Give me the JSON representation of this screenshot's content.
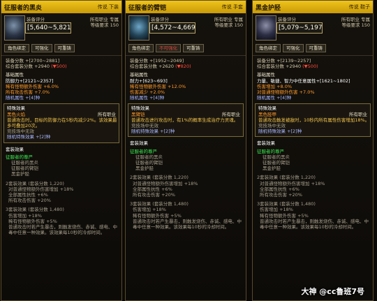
{
  "panels": [
    {
      "name": "征服者的黑炎",
      "tag": "传说 下装",
      "score_label": "装备评分",
      "score_value": "[5,640~5,821]",
      "job": "所有职业 专属",
      "level": "等级要求 150",
      "buttons": [
        "角色绑定",
        "可强化",
        "可重铸"
      ],
      "stat1": "装备分数 +[2700~2881]",
      "stat2": "综合套装分数 +2940",
      "stat2_delta": "(▼500)",
      "base_title": "基础属性",
      "base_lines": [
        "防御力+[2121~2357]"
      ],
      "orange_lines": [
        "稀有怪物额外伤害 +6.0%",
        "所有攻击伤害 +7.0%"
      ],
      "rand_attr": "随机属性 +[4]种",
      "effect_title": "特殊效果",
      "effect_name": "黑色火焰",
      "effect_job": "所有职业",
      "effect_desc": "普通攻击时，目标的防御力在5秒内减少2%。该效果最多可叠加20次。",
      "effect_pvp": "竞技场中无效",
      "rand_effect": "随机特殊效果 +[2]种",
      "set_title": "套装效果",
      "set_name": "征服者的尊严",
      "set_items": [
        "征服者的黑炎",
        "征服者的臂铠",
        "黑金护胫"
      ],
      "set2_head": "2套装效果 (套装分数 1,220)",
      "set2_lines": [
        "对普通怪物额外伤害增加 +18%",
        "全部属性抗性 +6%",
        "所有攻击伤害 +20%"
      ],
      "set3_head": "3套装效果 (套装分数 1,480)",
      "set3_lines": [
        "伤害增加 +18%",
        "稀有怪物额外伤害 +5%",
        "普通攻击时若产生暴击，则触发烧伤、赤诚、感电、中毒中任意一种效果。该效果每10秒的冷却时间。"
      ]
    },
    {
      "name": "征服者的臂铠",
      "tag": "传说 手套",
      "score_label": "装备评分",
      "score_value": "[4,572~4,669]",
      "job": "所有职业 专属",
      "level": "等级要求 150",
      "buttons": [
        "角色绑定",
        "不可强化",
        "可重铸"
      ],
      "stat1": "装备分数 +[1952~2049]",
      "stat2": "综合套装分数 +2620",
      "stat2_delta": "(▼820)",
      "base_title": "基础属性",
      "base_lines": [
        "耐力+[623~693]"
      ],
      "orange_lines": [
        "稀有怪物额外伤害 +12.0%",
        "伤害减少 +2.0%"
      ],
      "rand_attr": "随机属性 +[4]种",
      "effect_title": "特殊效果",
      "effect_name": "黑臂铠",
      "effect_job": "所有职业",
      "effect_desc": "普通攻击进行攻击时，有1%的概率生成治疗力灵魂。",
      "effect_pvp": "竞技场中无效",
      "rand_effect": "随机特殊效果 +[2]种",
      "set_title": "套装效果",
      "set_name": "征服者的尊严",
      "set_items": [
        "征服者的黑炎",
        "征服者的臂铠",
        "黑金护胫"
      ],
      "set2_head": "2套装效果 (套装分数 1,220)",
      "set2_lines": [
        "对普通怪物额外伤害增加 +18%",
        "全部属性抗性 +6%",
        "所有攻击伤害 +20%"
      ],
      "set3_head": "3套装效果 (套装分数 1,480)",
      "set3_lines": [
        "伤害增加 +18%",
        "稀有怪物额外伤害 +5%",
        "普通攻击时若产生暴击，则触发烧伤、赤诚、感电、中毒中任意一种效果。该效果每10秒的冷却时间。"
      ]
    },
    {
      "name": "黑金护胫",
      "tag": "传说 鞋子",
      "score_label": "装备评分",
      "score_value": "[5,079~5,197]",
      "job": "所有职业 专属",
      "level": "等级要求 150",
      "buttons": [
        "角色绑定",
        "可强化",
        "可重铸"
      ],
      "stat1": "装备分数 +[2139~2257]",
      "stat2": "综合套装分数 +2940",
      "stat2_delta": "(▼500)",
      "base_title": "基础属性",
      "base_lines": [
        "力量、敏捷、智力中任意属性+[1621~1802]"
      ],
      "orange_lines": [
        "伤害增加 +8.0%",
        "对普通怪物额外伤害 +7.0%"
      ],
      "rand_attr": "随机属性 +[4]种",
      "effect_title": "特殊效果",
      "effect_name": "黑色胫甲",
      "effect_job": "所有职业",
      "effect_desc": "普通攻击触发被敌时，10秒内所有属性伤害增加18%。",
      "effect_pvp": "竞技场中无效",
      "rand_effect": "随机特殊效果 +[2]种",
      "set_title": "套装效果",
      "set_name": "征服者的尊严",
      "set_items": [
        "征服者的黑炎",
        "征服者的臂铠",
        "黑金护胫"
      ],
      "set2_head": "2套装效果 (套装分数 1,220)",
      "set2_lines": [
        "对普通怪物额外伤害增加 +18%",
        "全部属性抗性 +6%",
        "所有攻击伤害 +20%"
      ],
      "set3_head": "3套装效果 (套装分数 1,480)",
      "set3_lines": [
        "伤害增加 +18%",
        "稀有怪物额外伤害 +5%",
        "普通攻击时若产生暴击，则触发烧伤、赤诚、感电、中毒中任意一种效果。该效果每10秒的冷却时间。"
      ]
    }
  ],
  "watermark": "大神 @cc鲁班7号",
  "colors": {
    "header": "#f0c419",
    "legendary_border": "#5a4a2a",
    "orange": "#ff9a2b",
    "green": "#39e94e",
    "red": "#ff4b3a"
  }
}
